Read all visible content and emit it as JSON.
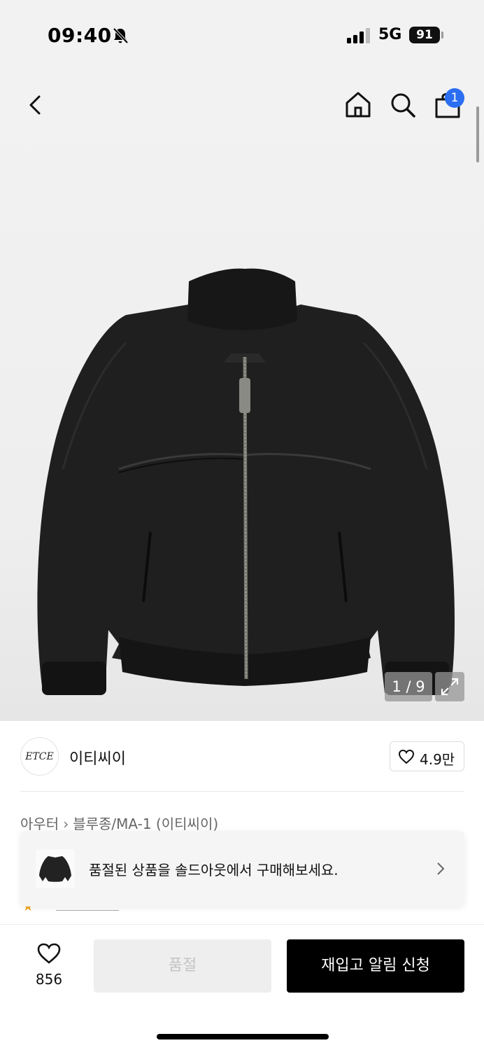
{
  "status_bar": {
    "time": "09:40",
    "network": "5G",
    "battery": "91"
  },
  "header": {
    "cart_count": "1"
  },
  "gallery": {
    "counter": "1 / 9"
  },
  "brand": {
    "logo_text": "ETCE",
    "name": "이티씨이",
    "likes": "4.9만"
  },
  "breadcrumb": {
    "items": [
      "아우터",
      "블루종/MA-1 (이티씨이)"
    ]
  },
  "toast": {
    "message": "품절된 상품을 솔드아웃에서 구매해보세요."
  },
  "bottom_bar": {
    "wish_count": "856",
    "soldout_label": "품절",
    "restock_label": "재입고 알림 신청"
  },
  "icons": [
    "bell-slash-icon",
    "signal-icon",
    "back-arrow-icon",
    "home-icon",
    "search-icon",
    "shopping-bag-icon",
    "expand-icon",
    "heart-icon",
    "chevron-right-icon",
    "star-icon"
  ],
  "colors": {
    "badge": "#2b6ef2",
    "primary_button": "#000000",
    "disabled_button": "#eeeeee"
  }
}
